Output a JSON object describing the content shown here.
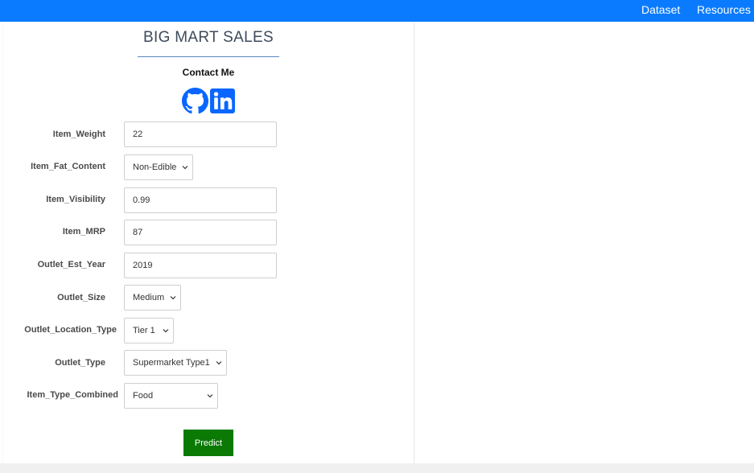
{
  "nav": {
    "dataset_label": "Dataset",
    "resources_label": "Resources"
  },
  "header": {
    "title": "BIG MART SALES",
    "contact_label": "Contact Me"
  },
  "social": {
    "github_icon": "github-icon",
    "linkedin_icon": "linkedin-icon"
  },
  "form": {
    "item_weight": {
      "label": "Item_Weight",
      "value": "22"
    },
    "item_fat_content": {
      "label": "Item_Fat_Content",
      "selected": "Non-Edible"
    },
    "item_visibility": {
      "label": "Item_Visibility",
      "value": "0.99"
    },
    "item_mrp": {
      "label": "Item_MRP",
      "value": "87"
    },
    "outlet_est_year": {
      "label": "Outlet_Est_Year",
      "value": "2019"
    },
    "outlet_size": {
      "label": "Outlet_Size",
      "selected": "Medium"
    },
    "outlet_location_type": {
      "label": "Outlet_Location_Type",
      "selected": "Tier 1"
    },
    "outlet_type": {
      "label": "Outlet_Type",
      "selected": "Supermarket Type1"
    },
    "item_type_combined": {
      "label": "Item_Type_Combined",
      "selected": "Food"
    }
  },
  "actions": {
    "predict_label": "Predict"
  },
  "colors": {
    "navbar": "#0a7bff",
    "predict_button": "#0a7a05",
    "icon_blue": "#0a66ff"
  }
}
